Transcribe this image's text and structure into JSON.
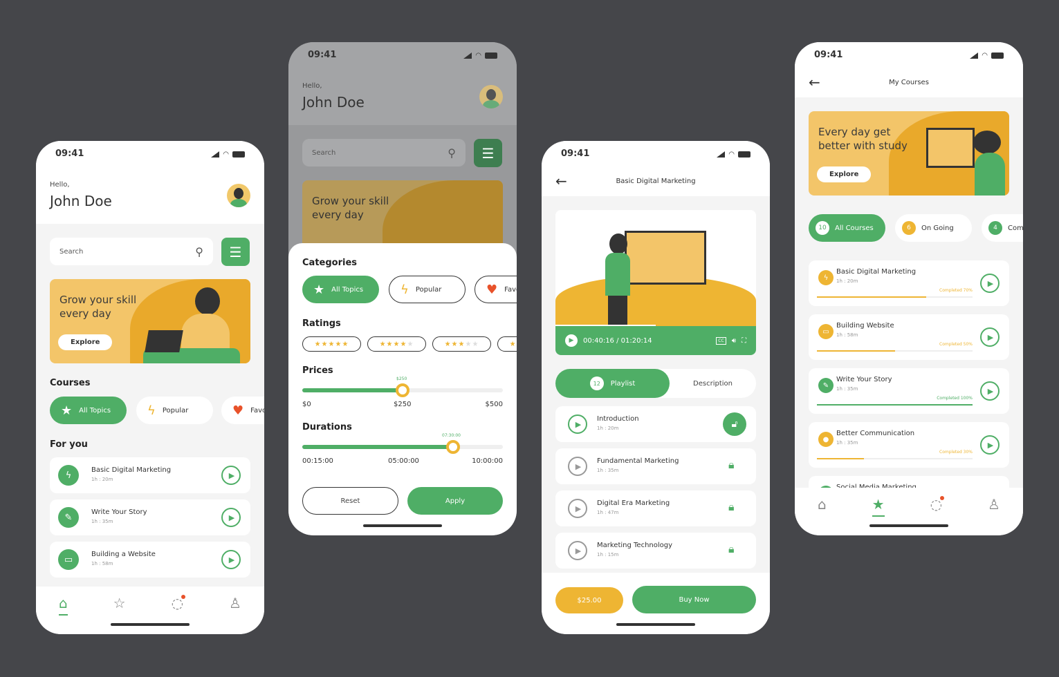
{
  "colors": {
    "background": "#45464a",
    "primary": "#4fae66",
    "accent": "#eeb533",
    "heart": "#e8522a"
  },
  "status_time": "09:41",
  "home": {
    "greeting": "Hello,",
    "user": "John Doe",
    "search_placeholder": "Search",
    "banner_title": "Grow your skill every day",
    "explore": "Explore",
    "courses_heading": "Courses",
    "chips": [
      {
        "label": "All Topics",
        "icon": "star-icon"
      },
      {
        "label": "Popular",
        "icon": "lightning-icon"
      },
      {
        "label": "Favo",
        "icon": "heart-icon"
      }
    ],
    "for_you_heading": "For you",
    "for_you": [
      {
        "title": "Basic Digital Marketing",
        "duration": "1h : 20m",
        "icon": "lightning-icon"
      },
      {
        "title": "Write Your Story",
        "duration": "1h : 35m",
        "icon": "pen-icon"
      },
      {
        "title": "Building a Website",
        "duration": "1h : 58m",
        "icon": "monitor-icon"
      }
    ],
    "nav": [
      "home-icon",
      "star-icon",
      "chat-icon",
      "profile-icon"
    ]
  },
  "filter": {
    "greeting": "Hello,",
    "user": "John Doe",
    "search_placeholder": "Search",
    "banner_title": "Grow your skill every day",
    "explore": "Explore",
    "categories_heading": "Categories",
    "chips": [
      {
        "label": "All Topics"
      },
      {
        "label": "Popular"
      },
      {
        "label": "Favo"
      }
    ],
    "ratings_heading": "Ratings",
    "ratings": [
      5,
      4,
      3,
      2
    ],
    "prices_heading": "Prices",
    "price": {
      "min": "$0",
      "mid": "$250",
      "max": "$500",
      "value": "$250",
      "fraction": 0.5
    },
    "durations_heading": "Durations",
    "duration": {
      "min": "00:15:00",
      "mid": "05:00:00",
      "max": "10:00:00",
      "value": "07:30:00",
      "fraction": 0.75
    },
    "reset": "Reset",
    "apply": "Apply"
  },
  "player": {
    "title": "Basic Digital Marketing",
    "time": "00:40:16 / 01:20:14",
    "progress": 0.5,
    "playlist_count": "12",
    "playlist_tab": "Playlist",
    "description_tab": "Description",
    "lessons": [
      {
        "title": "Introduction",
        "duration": "1h : 20m",
        "locked": false
      },
      {
        "title": "Fundamental Marketing",
        "duration": "1h : 35m",
        "locked": true
      },
      {
        "title": "Digital Era Marketing",
        "duration": "1h : 47m",
        "locked": true
      },
      {
        "title": "Marketing Technology",
        "duration": "1h : 15m",
        "locked": true
      }
    ],
    "price": "$25.00",
    "buy": "Buy Now"
  },
  "my_courses": {
    "title": "My Courses",
    "banner_title": "Every day get better with study",
    "explore": "Explore",
    "tabs": [
      {
        "count": "10",
        "label": "All Courses"
      },
      {
        "count": "6",
        "label": "On Going"
      },
      {
        "count": "4",
        "label": "Comp"
      }
    ],
    "courses": [
      {
        "title": "Basic Digital Marketing",
        "duration": "1h : 20m",
        "completed": "Completed 70%",
        "percent": 70
      },
      {
        "title": "Building Website",
        "duration": "1h : 58m",
        "completed": "Completed 50%",
        "percent": 50
      },
      {
        "title": "Write Your Story",
        "duration": "1h : 35m",
        "completed": "Completed 100%",
        "percent": 100
      },
      {
        "title": "Better Communication",
        "duration": "1h : 35m",
        "completed": "Completed 30%",
        "percent": 30
      },
      {
        "title": "Social Media Marketing"
      }
    ]
  }
}
